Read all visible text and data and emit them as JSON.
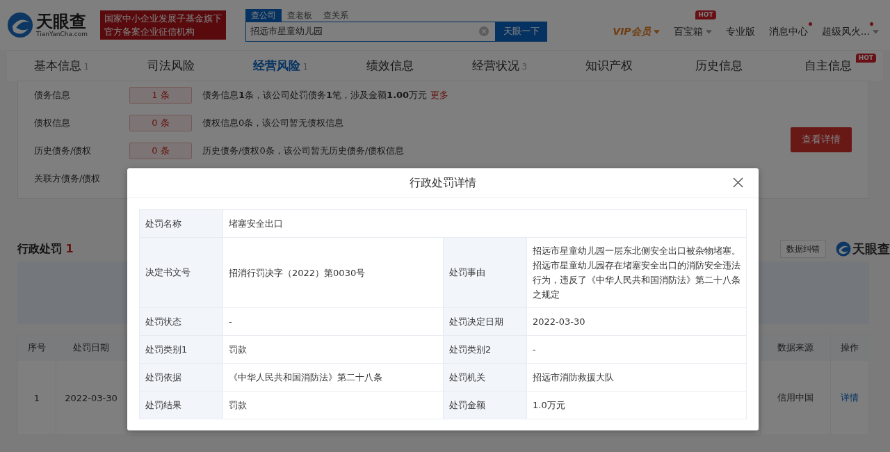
{
  "header": {
    "logo": {
      "name": "天眼查",
      "domain": "TianYanCha.com"
    },
    "slogan": [
      "国家中小企业发展子基金旗下",
      "官方备案企业征信机构"
    ],
    "search": {
      "tabs": [
        {
          "label": "查公司",
          "selected": true
        },
        {
          "label": "查老板",
          "selected": false
        },
        {
          "label": "查关系",
          "selected": false
        }
      ],
      "value": "招远市星童幼儿园",
      "button": "天眼一下"
    },
    "nav": [
      {
        "label": "VIP会员",
        "kind": "vip",
        "caret": true,
        "dot": false
      },
      {
        "label": "百宝箱",
        "kind": "plain",
        "caret": true,
        "dot": false,
        "badge": "HOT"
      },
      {
        "label": "专业版",
        "kind": "plain",
        "caret": false,
        "dot": false
      },
      {
        "label": "消息中心",
        "kind": "plain",
        "caret": false,
        "dot": true
      },
      {
        "label": "超级风火...",
        "kind": "plain",
        "caret": true,
        "dot": true
      }
    ]
  },
  "tabs": [
    {
      "label": "基本信息",
      "count": "1",
      "selected": false
    },
    {
      "label": "司法风险",
      "selected": false
    },
    {
      "label": "经营风险",
      "count": "1",
      "selected": true
    },
    {
      "label": "绩效信息",
      "selected": false
    },
    {
      "label": "经营状况",
      "count": "3",
      "selected": false
    },
    {
      "label": "知识产权",
      "selected": false
    },
    {
      "label": "历史信息",
      "selected": false
    },
    {
      "label": "自主信息",
      "selected": false,
      "badge": "HOT"
    }
  ],
  "debt_rows": [
    {
      "label": "债务信息",
      "count": "1 条",
      "description": "债务信息**1**条，该公司处罚债务**1**笔，涉及金额**1.00**万元",
      "link": "更多"
    },
    {
      "label": "债权信息",
      "count": "0 条",
      "description": "债权信息0条，该公司暂无债权信息"
    },
    {
      "label": "历史债务/债权",
      "count": "0 条",
      "description": "历史债务/债权0条，该公司暂无历史债务/债权信息"
    },
    {
      "label": "关联方债务/债权"
    }
  ],
  "detail_button": "查看详情",
  "penalty": {
    "title": "行政处罚",
    "count": "1",
    "correction": "数据纠错",
    "brand": "天眼查",
    "columns": [
      "序号",
      "处罚日期",
      "数据来源",
      "操作"
    ],
    "rows": [
      {
        "cells": [
          "1",
          "2022-03-30",
          "信用中国"
        ],
        "action": "详情"
      }
    ]
  },
  "modal": {
    "title": "行政处罚详情",
    "rows": [
      {
        "cells": [
          {
            "label": "处罚名称",
            "value": "堵塞安全出口"
          }
        ]
      },
      {
        "cells": [
          {
            "label": "决定书文号",
            "value": "招消行罚决字（2022）第0030号"
          },
          {
            "label": "处罚事由",
            "value": "招远市星童幼儿园一层东北侧安全出口被杂物堵塞。招远市星童幼儿园存在堵塞安全出口的消防安全违法行为，违反了《中华人民共和国消防法》第二十八条之规定"
          }
        ]
      },
      {
        "cells": [
          {
            "label": "处罚状态",
            "value": "-"
          },
          {
            "label": "处罚决定日期",
            "value": "2022-03-30"
          }
        ]
      },
      {
        "cells": [
          {
            "label": "处罚类别1",
            "value": "罚款"
          },
          {
            "label": "处罚类别2",
            "value": "-"
          }
        ]
      },
      {
        "cells": [
          {
            "label": "处罚依据",
            "value": "《中华人民共和国消防法》第二十八条"
          },
          {
            "label": "处罚机关",
            "value": "招远市消防救援大队"
          }
        ]
      },
      {
        "cells": [
          {
            "label": "处罚结果",
            "value": "罚款"
          },
          {
            "label": "处罚金额",
            "value": "1.0万元"
          }
        ]
      }
    ]
  }
}
